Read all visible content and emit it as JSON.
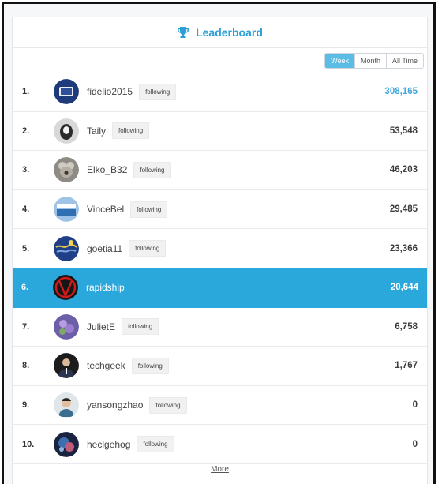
{
  "header": {
    "title": "Leaderboard",
    "icon": "trophy-icon"
  },
  "tabs": [
    {
      "label": "Week",
      "active": true
    },
    {
      "label": "Month",
      "active": false
    },
    {
      "label": "All Time",
      "active": false
    }
  ],
  "rows": [
    {
      "rank": "1.",
      "user": "fidelio2015",
      "badge": "following",
      "score": "308,165"
    },
    {
      "rank": "2.",
      "user": "Taily",
      "badge": "following",
      "score": "53,548"
    },
    {
      "rank": "3.",
      "user": "Elko_B32",
      "badge": "following",
      "score": "46,203"
    },
    {
      "rank": "4.",
      "user": "VinceBel",
      "badge": "following",
      "score": "29,485"
    },
    {
      "rank": "5.",
      "user": "goetia11",
      "badge": "following",
      "score": "23,366"
    },
    {
      "rank": "6.",
      "user": "rapidship",
      "badge": "",
      "score": "20,644"
    },
    {
      "rank": "7.",
      "user": "JulietE",
      "badge": "following",
      "score": "6,758"
    },
    {
      "rank": "8.",
      "user": "techgeek",
      "badge": "following",
      "score": "1,767"
    },
    {
      "rank": "9.",
      "user": "yansongzhao",
      "badge": "following",
      "score": "0"
    },
    {
      "rank": "10.",
      "user": "heclgehog",
      "badge": "following",
      "score": "0"
    }
  ],
  "more_label": "More",
  "colors": {
    "accent": "#2e9fd6",
    "highlight_row": "#2aa8dc",
    "active_tab": "#5bbde6"
  }
}
